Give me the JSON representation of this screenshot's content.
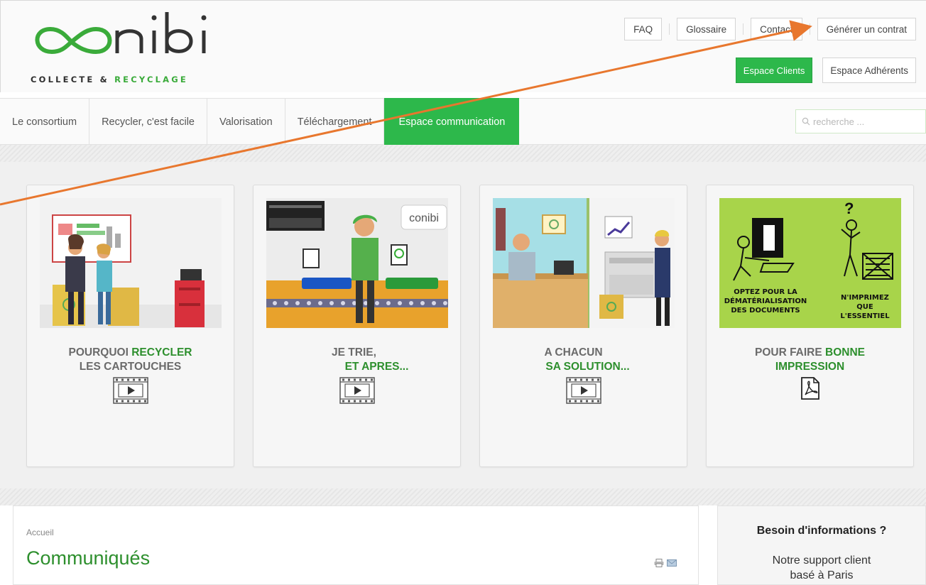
{
  "header": {
    "logo_text": "conibi",
    "logo_tag_1": "COLLECTE & ",
    "logo_tag_2": "RECYCLAGE",
    "top_links": [
      "FAQ",
      "Glossaire",
      "Contact",
      "Générer un contrat"
    ],
    "espace_clients": "Espace Clients",
    "espace_adherents": "Espace Adhérents"
  },
  "nav": {
    "items": [
      "Le consortium",
      "Recycler, c'est facile",
      "Valorisation",
      "Téléchargement",
      "Espace communication"
    ],
    "search_placeholder": "recherche ..."
  },
  "cards": [
    {
      "line1_plain": "POURQUOI ",
      "line1_green": "RECYCLER",
      "line2": "LES CARTOUCHES",
      "media": "video-icon"
    },
    {
      "line1": "JE TRIE,",
      "line2_green": "ET APRES...",
      "media": "video-icon"
    },
    {
      "line1": "A CHACUN",
      "line2_green": "SA SOLUTION...",
      "media": "video-icon"
    },
    {
      "line1_plain": "POUR FAIRE ",
      "line1_green": "BONNE",
      "line2_green": "IMPRESSION",
      "media": "pdf-icon"
    }
  ],
  "card3_art": {
    "left_text": "OPTEZ POUR LA DÉMATÉRIALISATION DES DOCUMENTS",
    "right_text": "N'IMPRIMEZ QUE L'ESSENTIEL"
  },
  "card2_art": {
    "sign_text": "conibi"
  },
  "content": {
    "breadcrumb": "Accueil",
    "title": "Communiqués"
  },
  "sidebar": {
    "title": "Besoin d'informations ?",
    "line1": "Notre support client",
    "line2": "basé à Paris"
  },
  "colors": {
    "brand_green": "#2db84b",
    "title_green": "#2d8f2d",
    "arrow": "#e8772e"
  }
}
